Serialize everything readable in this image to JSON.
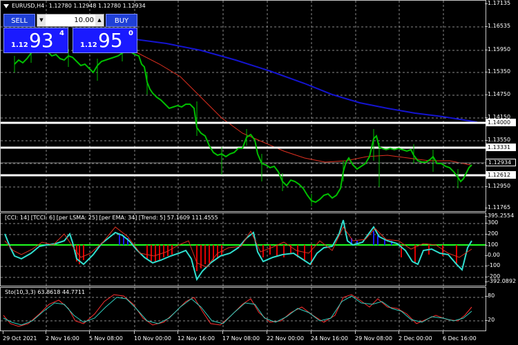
{
  "chart_header": {
    "symbol_tf": "EURUSD,H4",
    "ohlc": "1.12780 1.12948 1.12780 1.12934"
  },
  "trade_panel": {
    "sell_label": "SELL",
    "buy_label": "BUY",
    "lot_value": "10.00",
    "sell_quote": {
      "prefix": "1.12",
      "big": "93",
      "sup": "4"
    },
    "buy_quote": {
      "prefix": "1.12",
      "big": "95",
      "sup": "0"
    }
  },
  "price_axis": [
    "1.17135",
    "1.16535",
    "1.15950",
    "1.15350",
    "1.14750",
    "1.14150",
    "1.13550",
    "1.12950",
    "1.12350",
    "1.11765"
  ],
  "horizontal_levels": [
    "1.14000",
    "1.13331",
    "1.12612"
  ],
  "current_price": "1.12934",
  "cci_panel": {
    "label": "[CCI: 14] [TCCI: 6] [per LSMA: 25] [per EMA: 34] [Trend: 5]  57.1609 111.4555",
    "axis": [
      "395.2554",
      "300",
      "200",
      "100",
      "0.00",
      "-100",
      "-200",
      "-300",
      "-392.0892"
    ]
  },
  "sto_panel": {
    "label": "Sto(10,3,3) 63.8618 44.7711",
    "axis": [
      "80",
      "20"
    ]
  },
  "time_axis": [
    "29 Oct 2021",
    "2 Nov 16:00",
    "5 Nov 08:00",
    "10 Nov 00:00",
    "12 Nov 16:00",
    "17 Nov 08:00",
    "22 Nov 00:00",
    "24 Nov 16:00",
    "29 Nov 08:00",
    "2 Dec 00:00",
    "6 Dec 16:00"
  ],
  "colors": {
    "candle": "#00c000",
    "ma_slow": "#1414d0",
    "ma_fast": "#e03020",
    "level": "#ffffff",
    "cci_neg": "#e00000",
    "cci_pos": "#1a1aff",
    "sto_main": "#ff3030",
    "sto_signal": "#30d0c0"
  }
}
